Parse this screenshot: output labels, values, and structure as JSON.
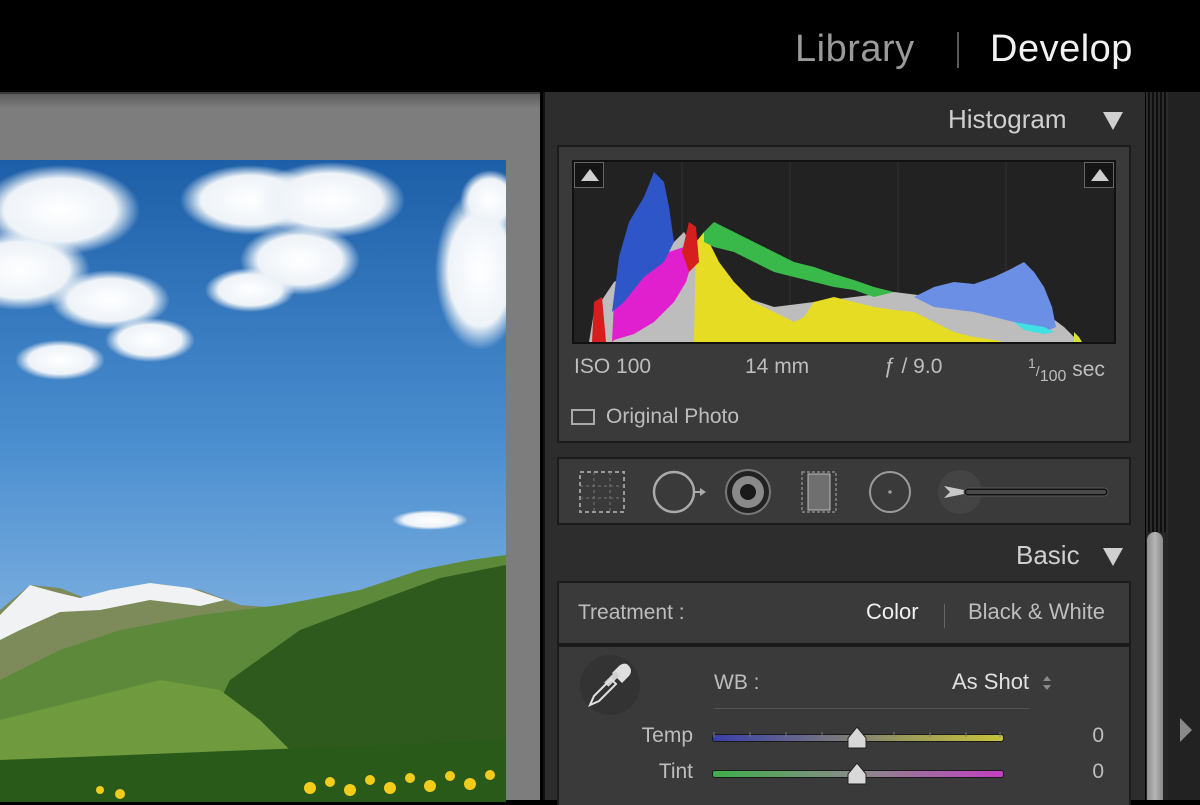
{
  "header": {
    "modules": [
      {
        "label": "Library",
        "active": false
      },
      {
        "label": "Develop",
        "active": true
      }
    ]
  },
  "histogram": {
    "title": "Histogram",
    "exif": {
      "iso": "ISO 100",
      "focal_length": "14 mm",
      "aperture": "ƒ / 9.0",
      "shutter_numerator": "1",
      "shutter_denominator": "100",
      "shutter_unit": "sec"
    },
    "original_photo_label": "Original Photo",
    "original_photo_checked": false
  },
  "tool_strip": {
    "tools": [
      "crop-overlay-icon",
      "spot-removal-icon",
      "red-eye-icon",
      "graduated-filter-icon",
      "radial-filter-icon",
      "adjustment-brush-icon"
    ]
  },
  "basic": {
    "title": "Basic",
    "treatment_label": "Treatment :",
    "treatment_color": "Color",
    "treatment_bw": "Black & White",
    "treatment_selected": "Color",
    "wb_label": "WB :",
    "wb_value": "As Shot",
    "sliders": [
      {
        "label": "Temp",
        "value": "0",
        "position": 0.5
      },
      {
        "label": "Tint",
        "value": "0",
        "position": 0.5
      }
    ]
  },
  "colors": {
    "background": "#000000",
    "panel": "#2d2d2d",
    "viewer": "#7d7d7d",
    "active_text": "#f2f2f2",
    "inactive_text": "#9a9a9a"
  }
}
